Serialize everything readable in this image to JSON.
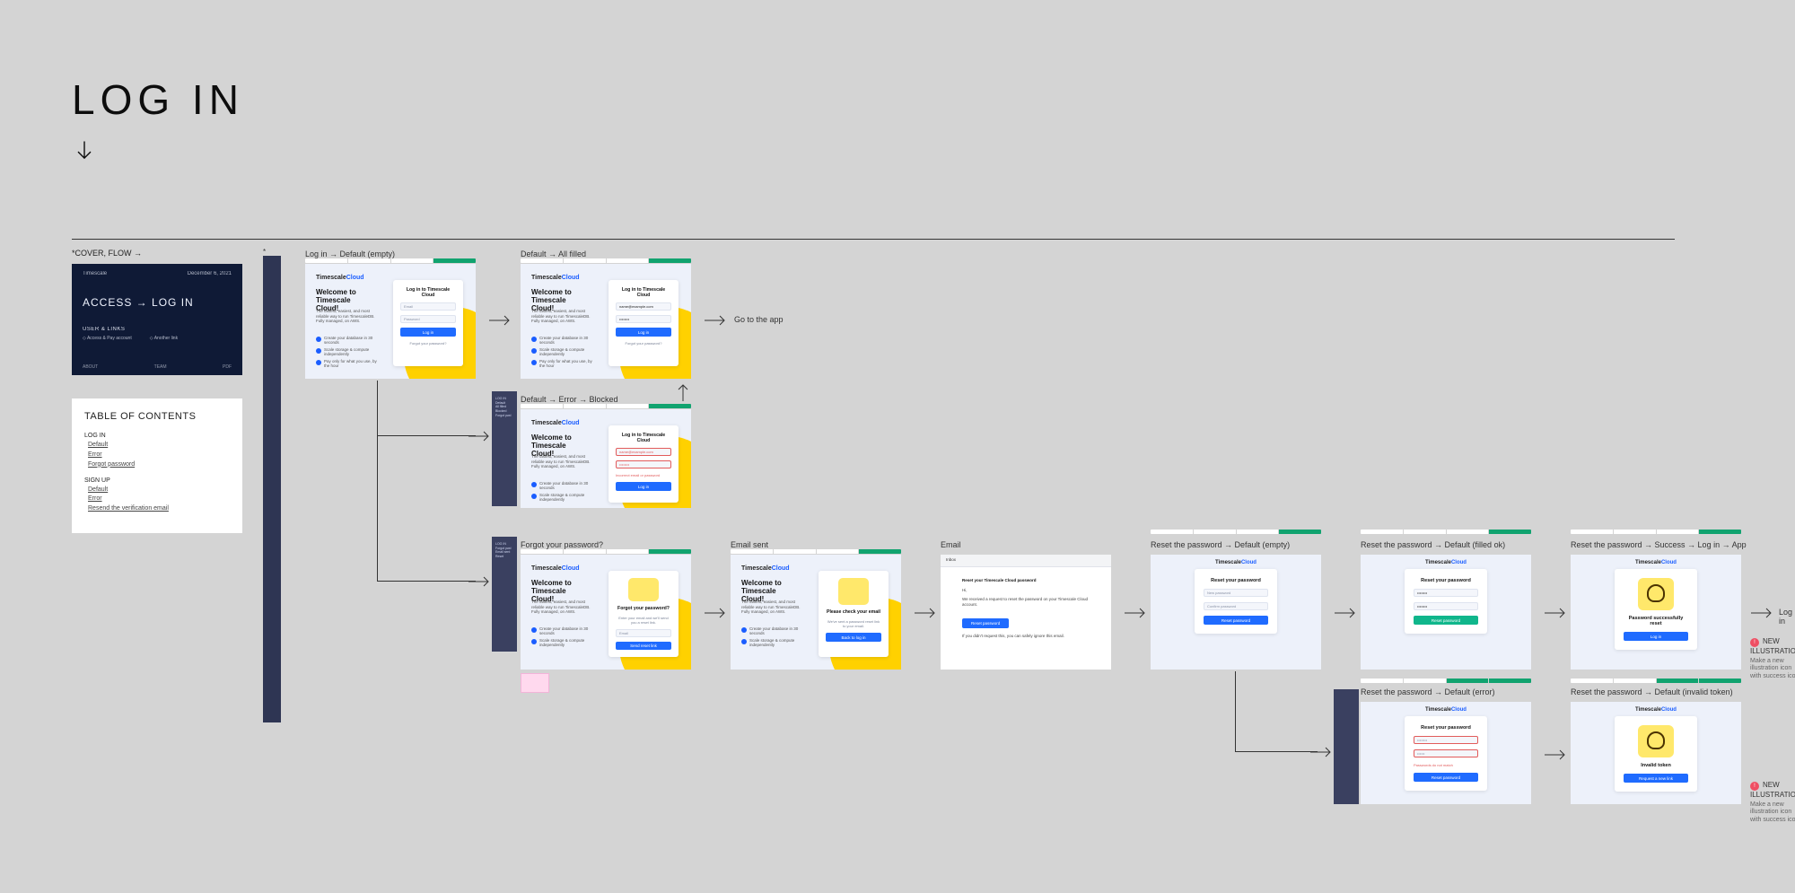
{
  "page": {
    "title": "LOG IN",
    "cover_label": "*COVER, FLOW →"
  },
  "cover": {
    "logo": "Timescale",
    "date": "December 6, 2021",
    "title": "ACCESS → LOG IN",
    "subhead": "USER & LINKS",
    "dot1": "Access & Pay account",
    "dot2": "Another link",
    "foot1": "ABOUT",
    "foot2": "TEAM",
    "foot3": "PDF"
  },
  "toc": {
    "title": "TABLE OF CONTENTS",
    "group1": {
      "head": "LOG IN",
      "i1": "Default",
      "i2": "Error",
      "i3": "Forgot password"
    },
    "group2": {
      "head": "SIGN UP",
      "i1": "Default",
      "i2": "Error",
      "i3": "Resend the verification email"
    }
  },
  "token_strip_label": "*",
  "frames": {
    "f1": {
      "label": "Log in → Default (empty)"
    },
    "f2": {
      "label": "Default → All filled"
    },
    "f3": {
      "label": "Default → Error → Blocked"
    },
    "f4": {
      "label": "Forgot your password?"
    },
    "f5": {
      "label": "Email sent"
    },
    "f6": {
      "label": "Email"
    },
    "f7": {
      "label": "Reset the password → Default (empty)"
    },
    "f8": {
      "label": "Reset the password → Default (filled ok)"
    },
    "f9": {
      "label": "Reset the password → Success → Log in → App"
    },
    "f10": {
      "label": "Reset the password → Default (error)"
    },
    "f11": {
      "label": "Reset the password → Default (invalid token)"
    }
  },
  "screen": {
    "brand_a": "Timescale",
    "brand_b": "Cloud",
    "welcome": "Welcome to Timescale Cloud!",
    "blurb": "The fastest, easiest, and most reliable way to run TimescaleDB. Fully managed, on AWS.",
    "b1": "Create your database in 30 seconds",
    "b2": "Scale storage & compute independently",
    "b3": "Pay only for what you use, by the hour",
    "login_card": {
      "title": "Log in to Timescale Cloud",
      "email_ph": "Email",
      "pass_ph": "Password",
      "btn": "Log in",
      "help": "Forgot your password?"
    },
    "err": "Incorrect email or password",
    "forgot_card": {
      "title": "Forgot your password?",
      "sub": "Enter your email and we'll send you a reset link.",
      "btn": "Send reset link"
    },
    "sent_card": {
      "title": "Please check your email",
      "sub": "We've sent a password reset link to your email.",
      "btn": "Back to log in"
    },
    "reset_card": {
      "title": "Reset your password",
      "f1": "New password",
      "f2": "Confirm password",
      "btn": "Reset password"
    },
    "success_card": {
      "title": "Password successfully reset",
      "btn": "Log in"
    },
    "invalid_card": {
      "title": "Invalid token",
      "btn": "Request a new link"
    },
    "reset_err": "Passwords do not match"
  },
  "email": {
    "from": "Inbox",
    "subject": "Reset your Timescale Cloud password",
    "l1": "Hi,",
    "l2": "We received a request to reset the password on your Timescale Cloud account.",
    "l3": "If you didn't request this, you can safely ignore this email.",
    "btn": "Reset password"
  },
  "flow": {
    "go_to_app": "Go to the app",
    "log_in": "Log in"
  },
  "anno": {
    "tag": "NEW ILLUSTRATION",
    "sub": "Make a new illustration icon with success icon"
  },
  "mini_side": {
    "head": "LOG IN",
    "l1": "Default",
    "l2": "All filled",
    "l3": "Blocked",
    "l4": "Forgot pwd",
    "l5": "Email sent",
    "l6": "Reset"
  }
}
